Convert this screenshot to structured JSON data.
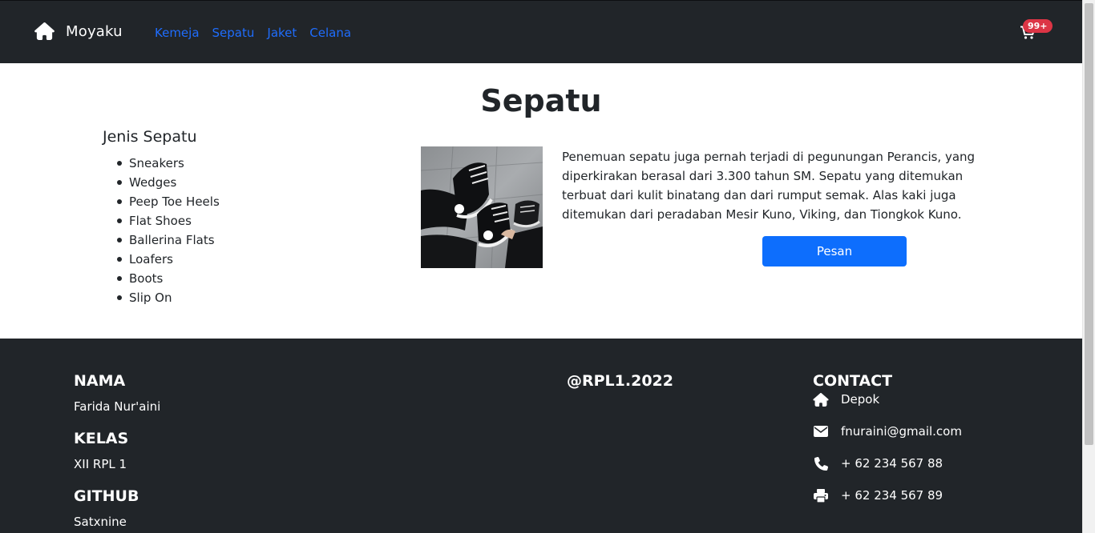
{
  "navbar": {
    "brand": "Moyaku",
    "links": [
      "Kemeja",
      "Sepatu",
      "Jaket",
      "Celana"
    ],
    "cart_badge": "99+"
  },
  "main": {
    "title": "Sepatu",
    "types_heading": "Jenis Sepatu",
    "types": [
      "Sneakers",
      "Wedges",
      "Peep Toe Heels",
      "Flat Shoes",
      "Ballerina Flats",
      "Loafers",
      "Boots",
      "Slip On"
    ],
    "description": "Penemuan sepatu juga pernah terjadi di pegunungan Perancis, yang diperkirakan berasal dari 3.300 tahun SM. Sepatu yang ditemukan terbuat dari kulit binatang dan dari rumput semak. Alas kaki juga ditemukan dari peradaban Mesir Kuno, Viking, dan Tiongkok Kuno.",
    "order_button": "Pesan"
  },
  "footer": {
    "name_heading": "NAMA",
    "name_value": "Farida Nur'aini",
    "class_heading": "KELAS",
    "class_value": "XII RPL 1",
    "github_heading": "GITHUB",
    "github_value": "Satxnine",
    "handle": "@RPL1.2022",
    "contact_heading": "CONTACT",
    "contact": {
      "location": "Depok",
      "email": "fnuraini@gmail.com",
      "phone": "+ 62 234 567 88",
      "fax": "+ 62 234 567 89"
    }
  },
  "colors": {
    "dark_bg": "#212529",
    "link": "#1f6dfd",
    "primary_button": "#0d6efd",
    "badge": "#dc3545"
  },
  "icons": [
    "home-icon",
    "cart-icon",
    "location-home-icon",
    "email-icon",
    "phone-icon",
    "fax-icon"
  ]
}
